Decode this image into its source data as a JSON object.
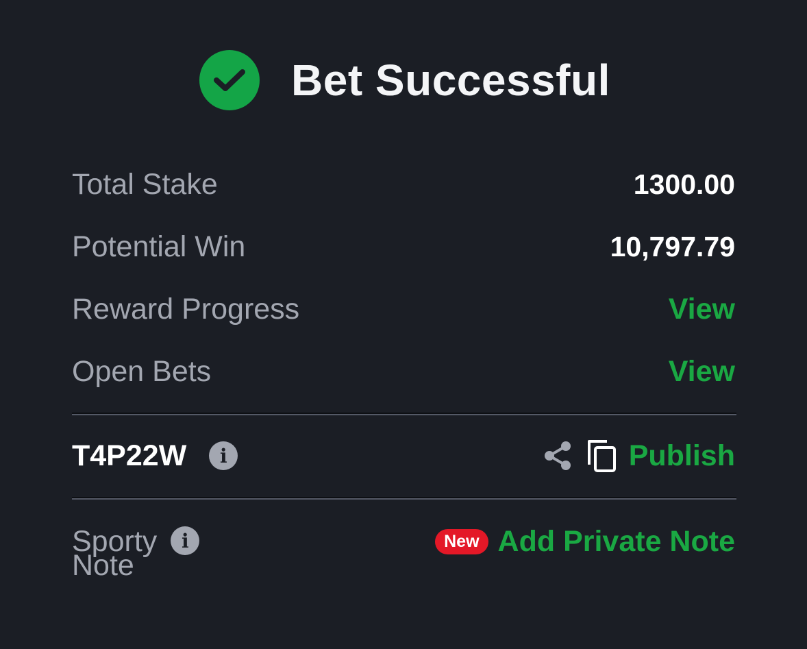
{
  "header": {
    "title": "Bet Successful",
    "icon": "check-circle-icon",
    "icon_color": "#14a547"
  },
  "summary": {
    "total_stake_label": "Total Stake",
    "total_stake_value": "1300.00",
    "potential_win_label": "Potential Win",
    "potential_win_value": "10,797.79",
    "reward_progress_label": "Reward Progress",
    "reward_progress_link": "View",
    "open_bets_label": "Open Bets",
    "open_bets_link": "View"
  },
  "booking": {
    "code": "T4P22W",
    "info_icon": "info-icon",
    "share_icon": "share-icon",
    "copy_icon": "copy-icon",
    "publish_label": "Publish"
  },
  "note": {
    "label_line1": "Sporty",
    "label_line2": "Note",
    "badge": "New",
    "add_label": "Add Private Note"
  },
  "colors": {
    "background": "#1b1e25",
    "accent_green": "#1aa843",
    "badge_red": "#e41827",
    "muted_text": "#a3a7b1"
  }
}
